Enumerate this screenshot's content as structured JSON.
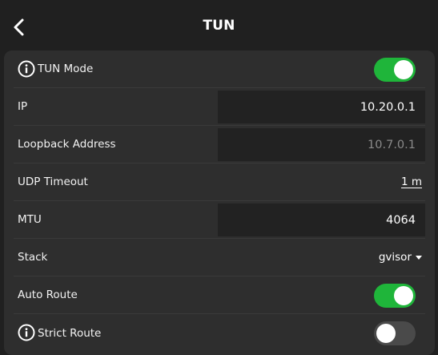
{
  "header": {
    "title": "TUN",
    "back_icon": "chevron-left-icon"
  },
  "settings": {
    "tun_mode": {
      "label": "TUN Mode",
      "icon": "info-icon",
      "enabled": true
    },
    "ip": {
      "label": "IP",
      "value": "10.20.0.1"
    },
    "loopback_address": {
      "label": "Loopback Address",
      "placeholder": "10.7.0.1"
    },
    "udp_timeout": {
      "label": "UDP Timeout",
      "value": "1 m"
    },
    "mtu": {
      "label": "MTU",
      "value": "4064"
    },
    "stack": {
      "label": "Stack",
      "value": "gvisor",
      "icon": "caret-down-icon"
    },
    "auto_route": {
      "label": "Auto Route",
      "enabled": true
    },
    "strict_route": {
      "label": "Strict Route",
      "icon": "info-icon",
      "enabled": false
    }
  },
  "colors": {
    "background": "#202020",
    "card": "#2e2e2e",
    "input": "#222222",
    "toggle_on": "#1fb53a",
    "toggle_off": "#4a4a4a"
  }
}
